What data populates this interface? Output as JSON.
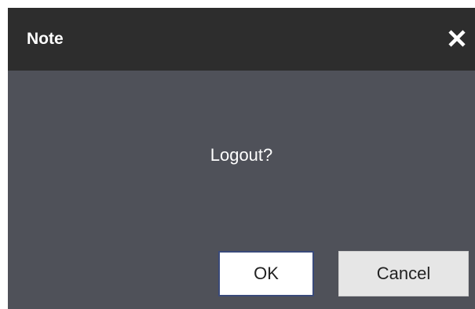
{
  "dialog": {
    "title": "Note",
    "close_icon": "close-icon",
    "message": "Logout?",
    "ok_label": "OK",
    "cancel_label": "Cancel"
  },
  "colors": {
    "titlebar": "#2d2d2d",
    "body": "#4f5159",
    "ok_background": "#ffffff",
    "cancel_background": "#e6e6e6",
    "focus_border": "#3a4a7a"
  }
}
